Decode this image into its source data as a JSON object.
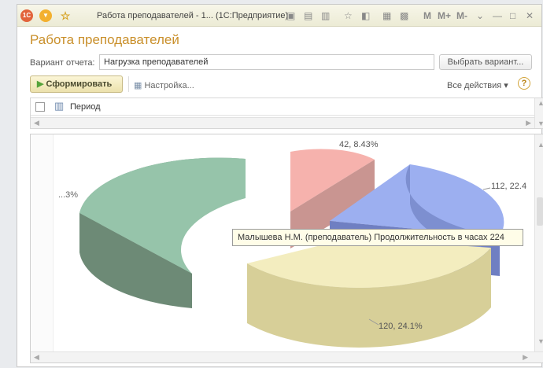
{
  "window": {
    "title": "Работа преподавателей - 1...  (1С:Предприятие)",
    "buttons": [
      "M",
      "M+",
      "M-"
    ]
  },
  "form": {
    "title": "Работа преподавателей",
    "variant_label": "Вариант отчета:",
    "variant_value": "Нагрузка преподавателей",
    "select_variant_button": "Выбрать вариант..."
  },
  "toolbar": {
    "generate_button": "Сформировать",
    "settings_button": "Настройка...",
    "all_actions": "Все действия",
    "help": "?"
  },
  "settings": {
    "period_label": "Период"
  },
  "chart_data": {
    "type": "pie",
    "slices": [
      {
        "label": "...3%",
        "value": null,
        "percent": null,
        "color": "#8fbfa4"
      },
      {
        "label": "42, 8.43%",
        "value": 42,
        "percent": 8.43,
        "color": "#f5aaa3"
      },
      {
        "label": "112, 22.4",
        "value": 112,
        "percent": 22.4,
        "color": "#8da3e6"
      },
      {
        "label": "120, 24.1%",
        "value": 120,
        "percent": 24.1,
        "color": "#e7ddb0"
      }
    ],
    "tooltip": "Малышева Н.М. (преподаватель) Продолжительность в часах 224",
    "legend": "none"
  }
}
